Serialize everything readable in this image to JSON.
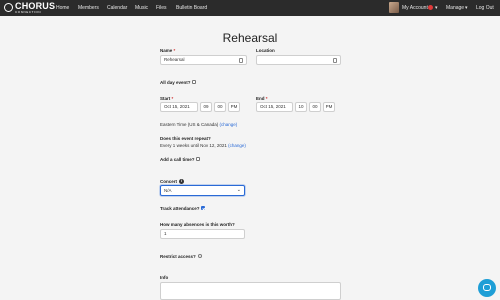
{
  "nav": {
    "logo_text": "CHORUS",
    "logo_sub": "CONNECTION",
    "links": [
      "Home",
      "Members",
      "Calendar",
      "Music",
      "Files",
      "Bulletin Board"
    ],
    "account_label": "My Account",
    "manage_label": "Manage",
    "logout_label": "Log Out"
  },
  "page": {
    "title": "Rehearsal"
  },
  "form": {
    "name_label": "Name",
    "name_value": "Rehearsal",
    "location_label": "Location",
    "location_value": "",
    "all_day_label": "All day event?",
    "start_label": "Start",
    "start_date": "Oct 15, 2021",
    "start_hour": "09",
    "start_min": "00",
    "start_ampm": "PM",
    "end_label": "End",
    "end_date": "Oct 15, 2021",
    "end_hour": "10",
    "end_min": "00",
    "end_ampm": "PM",
    "timezone_text": "Eastern Time (US & Canada)",
    "timezone_link": "(change)",
    "repeat_label": "Does this event repeat?",
    "repeat_text_1": "Every",
    "repeat_count": "1",
    "repeat_text_2": "weeks until Nov 12, 2021",
    "repeat_link": "(change)",
    "call_time_label": "Add a call time?",
    "concert_label": "Concert",
    "concert_value": "N/A",
    "track_label": "Track attendance?",
    "absences_label": "How many absences is this worth?",
    "absences_value": "1",
    "restrict_label": "Restrict access?",
    "info_label": "Info"
  },
  "icons": {
    "calendar": "calendar-icon",
    "info": "info-icon",
    "chat": "chat-icon"
  },
  "colors": {
    "navbar": "#2b2b2b",
    "accent": "#2a6ad6",
    "required": "#d03030",
    "chat": "#1e9ed6"
  }
}
